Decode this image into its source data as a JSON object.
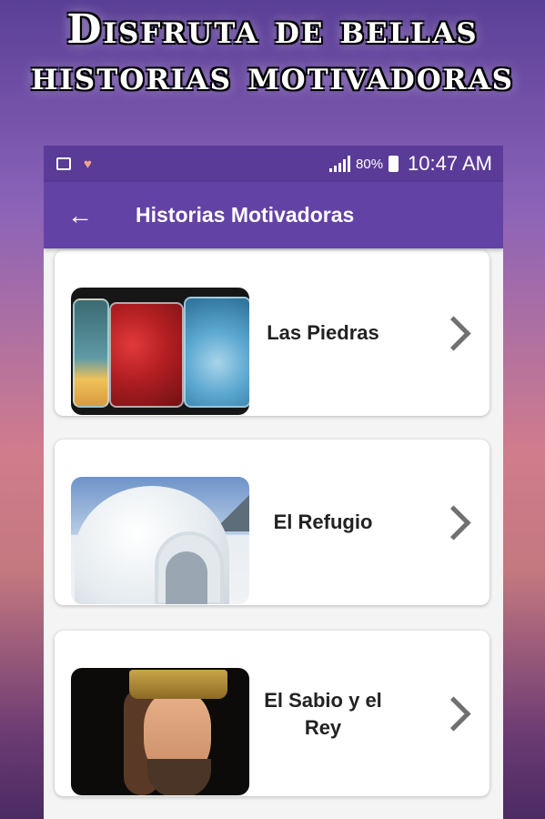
{
  "banner": {
    "line1": "Disfruta de bellas",
    "line2": "historias motivadoras"
  },
  "statusbar": {
    "battery_percent": "80%",
    "time": "10:47 AM"
  },
  "toolbar": {
    "title": "Historias Motivadoras"
  },
  "stories": [
    {
      "title": "Las Piedras"
    },
    {
      "title": "El Refugio"
    },
    {
      "title": "El Sabio y el Rey"
    }
  ],
  "colors": {
    "statusbar": "#5a3b98",
    "toolbar": "#6342a5"
  },
  "icons": {
    "back": "back-arrow-icon",
    "next": "chevron-right-icon"
  }
}
